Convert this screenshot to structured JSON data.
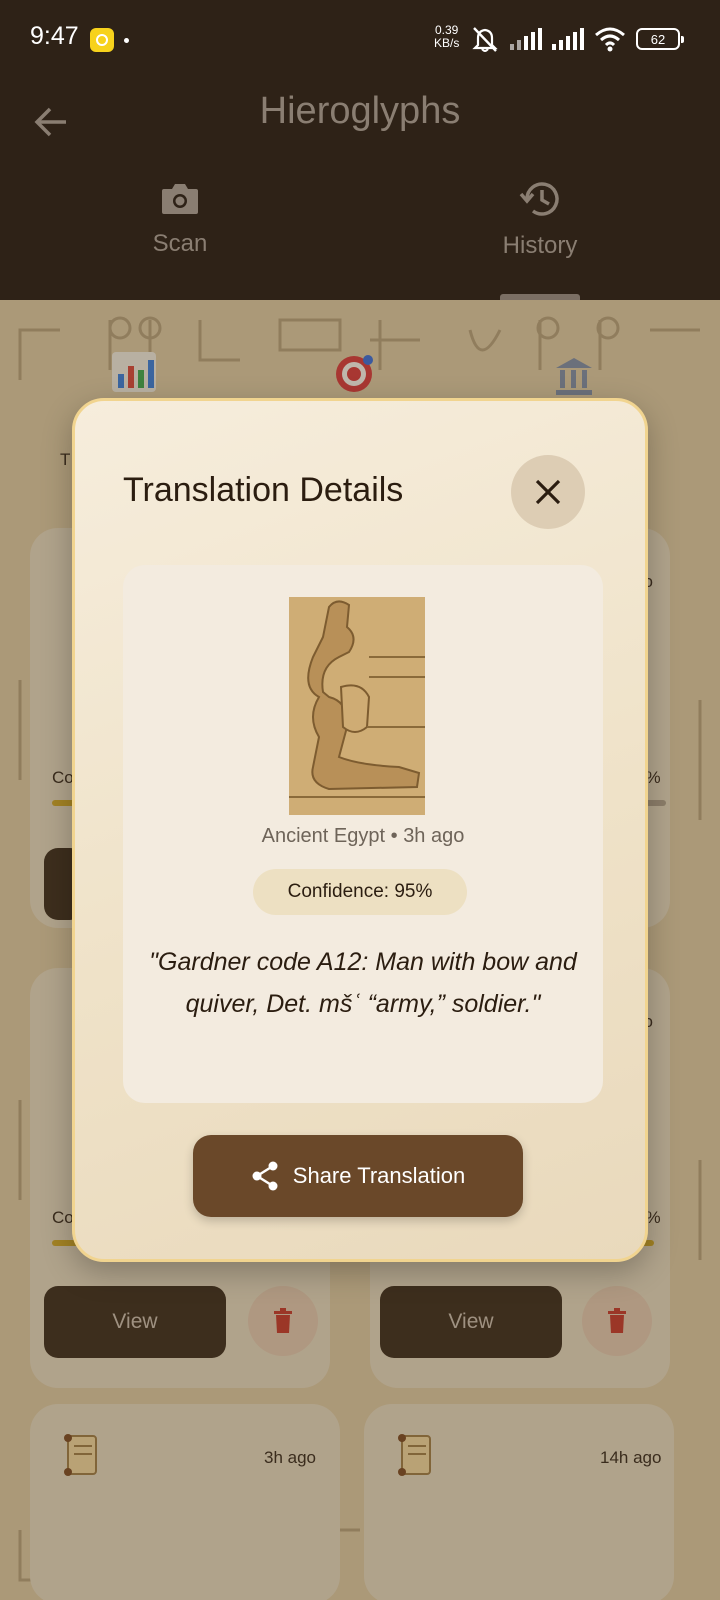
{
  "status_bar": {
    "time": "9:47",
    "speed_value": "0.39",
    "speed_unit": "KB/s",
    "battery": "62"
  },
  "app_bar": {
    "title": "Hieroglyphs",
    "tabs": [
      {
        "label": "Scan",
        "icon": "camera-icon"
      },
      {
        "label": "History",
        "icon": "history-icon"
      }
    ],
    "active_tab": "History"
  },
  "background": {
    "cards": [
      {
        "time": "",
        "view_label": "View"
      },
      {
        "time": "go",
        "view_label": "View"
      },
      {
        "time": "3h ago",
        "view_label": "View"
      },
      {
        "time": "14h ago",
        "view_label": "View"
      }
    ],
    "partial_texts": [
      "Co",
      "3%",
      "Co",
      "0%",
      "go",
      "T"
    ]
  },
  "dialog": {
    "title": "Translation Details",
    "origin": "Ancient Egypt",
    "separator": "•",
    "time": "3h ago",
    "confidence": "Confidence: 95%",
    "translation": "\"Gardner code A12: Man with bow and quiver, Det. mšʿ “army,” soldier.\"",
    "share_label": "Share Translation"
  },
  "colors": {
    "header_bg": "#2e2217",
    "accent_brown": "#6a4829",
    "dialog_border": "#f1d48f",
    "progress_gold": "#c9a227"
  }
}
